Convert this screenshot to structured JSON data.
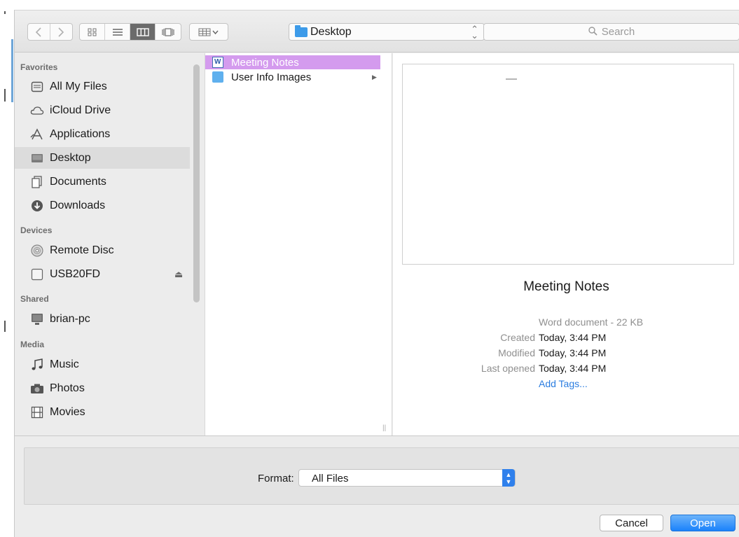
{
  "toolbar": {
    "location": "Desktop",
    "search_placeholder": "Search",
    "view_modes": [
      "icon-view",
      "list-view",
      "column-view",
      "cover-flow-view"
    ],
    "active_view": "column-view"
  },
  "sidebar": {
    "favorites_header": "Favorites",
    "favorites": [
      {
        "label": "All My Files",
        "icon": "all-files-icon"
      },
      {
        "label": "iCloud Drive",
        "icon": "cloud-icon"
      },
      {
        "label": "Applications",
        "icon": "applications-icon"
      },
      {
        "label": "Desktop",
        "icon": "desktop-icon",
        "selected": true
      },
      {
        "label": "Documents",
        "icon": "documents-icon"
      },
      {
        "label": "Downloads",
        "icon": "downloads-icon"
      }
    ],
    "devices_header": "Devices",
    "devices": [
      {
        "label": "Remote Disc",
        "icon": "disc-icon"
      },
      {
        "label": "USB20FD",
        "icon": "drive-icon",
        "eject": true
      }
    ],
    "shared_header": "Shared",
    "shared": [
      {
        "label": "brian-pc",
        "icon": "pc-icon"
      }
    ],
    "media_header": "Media",
    "media": [
      {
        "label": "Music",
        "icon": "music-icon"
      },
      {
        "label": "Photos",
        "icon": "camera-icon"
      },
      {
        "label": "Movies",
        "icon": "film-icon"
      }
    ]
  },
  "files": [
    {
      "name": "Meeting Notes",
      "type": "word-doc",
      "selected": true
    },
    {
      "name": "User Info Images",
      "type": "folder",
      "has_children": true
    }
  ],
  "preview": {
    "title": "Meeting Notes",
    "kind": "Word document - 22 KB",
    "created_label": "Created",
    "created_value": "Today, 3:44 PM",
    "modified_label": "Modified",
    "modified_value": "Today, 3:44 PM",
    "last_opened_label": "Last opened",
    "last_opened_value": "Today, 3:44 PM",
    "add_tags": "Add Tags..."
  },
  "format": {
    "label": "Format:",
    "selected": "All Files"
  },
  "buttons": {
    "cancel": "Cancel",
    "open": "Open"
  },
  "colors": {
    "selection": "#d49bee",
    "accent": "#2f80ec",
    "link": "#2b7de0"
  }
}
